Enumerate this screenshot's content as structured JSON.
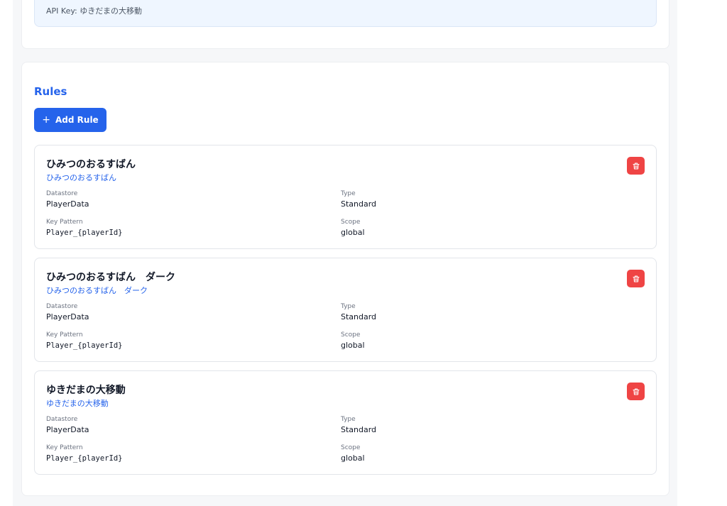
{
  "api_key": {
    "text": "API Key: ゆきだまの大移動"
  },
  "rules_section": {
    "heading": "Rules",
    "add_button_label": "Add Rule"
  },
  "labels": {
    "datastore": "Datastore",
    "type": "Type",
    "key_pattern": "Key Pattern",
    "scope": "Scope"
  },
  "rules": [
    {
      "title": "ひみつのおるすばん",
      "subtitle": "ひみつのおるすばん",
      "datastore": "PlayerData",
      "type": "Standard",
      "key_pattern": "Player_{playerId}",
      "scope": "global"
    },
    {
      "title": "ひみつのおるすばん　ダーク",
      "subtitle": "ひみつのおるすばん　ダーク",
      "datastore": "PlayerData",
      "type": "Standard",
      "key_pattern": "Player_{playerId}",
      "scope": "global"
    },
    {
      "title": "ゆきだまの大移動",
      "subtitle": "ゆきだまの大移動",
      "datastore": "PlayerData",
      "type": "Standard",
      "key_pattern": "Player_{playerId}",
      "scope": "global"
    }
  ],
  "icons": {
    "add": "plus-icon",
    "delete": "trash-icon"
  },
  "colors": {
    "accent": "#2563eb",
    "danger": "#ef4444",
    "info_background": "#eff6ff"
  }
}
